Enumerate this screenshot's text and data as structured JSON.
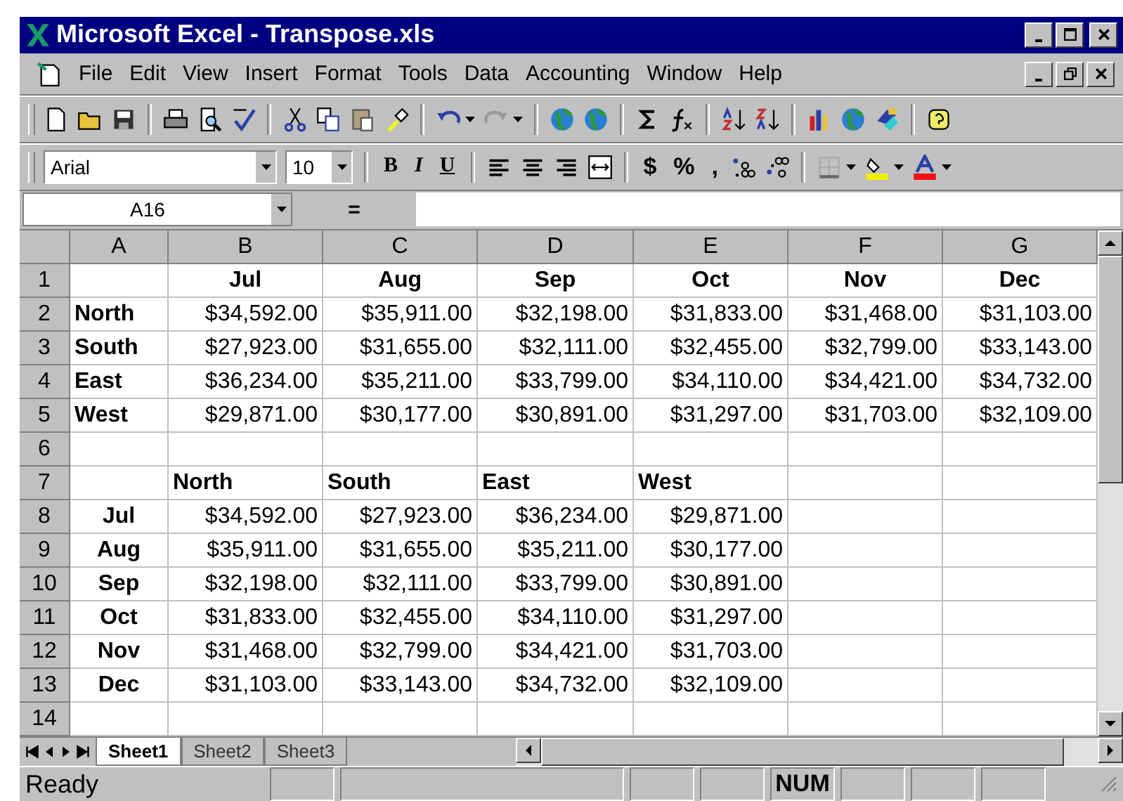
{
  "window": {
    "title": "Microsoft Excel - Transpose.xls"
  },
  "menu": [
    "File",
    "Edit",
    "View",
    "Insert",
    "Format",
    "Tools",
    "Data",
    "Accounting",
    "Window",
    "Help"
  ],
  "formatting": {
    "font": "Arial",
    "size": "10",
    "style_buttons": [
      "B",
      "I",
      "U"
    ],
    "number_buttons": [
      "$",
      "%",
      ","
    ]
  },
  "formula_bar": {
    "name_box": "A16",
    "equals": "="
  },
  "columns": [
    "A",
    "B",
    "C",
    "D",
    "E",
    "F",
    "G"
  ],
  "rows": [
    {
      "number": "1",
      "kind": "month_header",
      "cells": [
        "",
        "Jul",
        "Aug",
        "Sep",
        "Oct",
        "Nov",
        "Dec"
      ]
    },
    {
      "number": "2",
      "kind": "region_row",
      "cells": [
        "North",
        "$34,592.00",
        "$35,911.00",
        "$32,198.00",
        "$31,833.00",
        "$31,468.00",
        "$31,103.00"
      ]
    },
    {
      "number": "3",
      "kind": "region_row",
      "cells": [
        "South",
        "$27,923.00",
        "$31,655.00",
        "$32,111.00",
        "$32,455.00",
        "$32,799.00",
        "$33,143.00"
      ]
    },
    {
      "number": "4",
      "kind": "region_row",
      "cells": [
        "East",
        "$36,234.00",
        "$35,211.00",
        "$33,799.00",
        "$34,110.00",
        "$34,421.00",
        "$34,732.00"
      ]
    },
    {
      "number": "5",
      "kind": "region_row",
      "cells": [
        "West",
        "$29,871.00",
        "$30,177.00",
        "$30,891.00",
        "$31,297.00",
        "$31,703.00",
        "$32,109.00"
      ]
    },
    {
      "number": "6",
      "kind": "empty",
      "cells": [
        "",
        "",
        "",
        "",
        "",
        "",
        ""
      ]
    },
    {
      "number": "7",
      "kind": "region_header",
      "cells": [
        "",
        "North",
        "South",
        "East",
        "West",
        "",
        ""
      ]
    },
    {
      "number": "8",
      "kind": "month_row",
      "cells": [
        "Jul",
        "$34,592.00",
        "$27,923.00",
        "$36,234.00",
        "$29,871.00",
        "",
        ""
      ]
    },
    {
      "number": "9",
      "kind": "month_row",
      "cells": [
        "Aug",
        "$35,911.00",
        "$31,655.00",
        "$35,211.00",
        "$30,177.00",
        "",
        ""
      ]
    },
    {
      "number": "10",
      "kind": "month_row",
      "cells": [
        "Sep",
        "$32,198.00",
        "$32,111.00",
        "$33,799.00",
        "$30,891.00",
        "",
        ""
      ]
    },
    {
      "number": "11",
      "kind": "month_row",
      "cells": [
        "Oct",
        "$31,833.00",
        "$32,455.00",
        "$34,110.00",
        "$31,297.00",
        "",
        ""
      ]
    },
    {
      "number": "12",
      "kind": "month_row",
      "cells": [
        "Nov",
        "$31,468.00",
        "$32,799.00",
        "$34,421.00",
        "$31,703.00",
        "",
        ""
      ]
    },
    {
      "number": "13",
      "kind": "month_row",
      "cells": [
        "Dec",
        "$31,103.00",
        "$33,143.00",
        "$34,732.00",
        "$32,109.00",
        "",
        ""
      ]
    },
    {
      "number": "14",
      "kind": "empty",
      "cells": [
        "",
        "",
        "",
        "",
        "",
        "",
        ""
      ]
    }
  ],
  "sheet_tabs": [
    {
      "label": "Sheet1",
      "selected": true
    },
    {
      "label": "Sheet2",
      "selected": false
    },
    {
      "label": "Sheet3",
      "selected": false
    }
  ],
  "status_bar": {
    "status": "Ready",
    "indicators": [
      {
        "kind": "blank"
      },
      {
        "kind": "blank"
      },
      {
        "kind": "blank"
      },
      {
        "kind": "blank"
      },
      {
        "kind": "text",
        "label": "NUM"
      },
      {
        "kind": "blank"
      },
      {
        "kind": "blank"
      },
      {
        "kind": "blank"
      }
    ]
  }
}
